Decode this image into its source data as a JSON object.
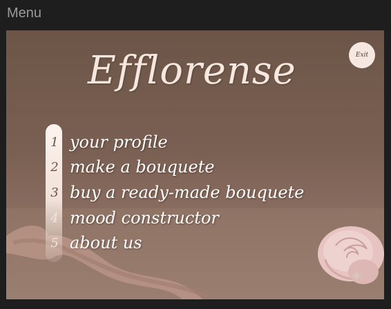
{
  "window": {
    "title": "Menu"
  },
  "app": {
    "logo_text": "Efflorense"
  },
  "exit_button": {
    "label": "Exit"
  },
  "menu": {
    "items": [
      {
        "number": "1",
        "label": "your profile"
      },
      {
        "number": "2",
        "label": "make a bouquete"
      },
      {
        "number": "3",
        "label": "buy a ready-made bouquete"
      },
      {
        "number": "4",
        "label": "mood constructor"
      },
      {
        "number": "5",
        "label": "about us"
      }
    ]
  },
  "colors": {
    "background_top": "#6c5548",
    "background_bottom": "#94796b",
    "logo": "#f6e7df",
    "exit_button_bg": "#f7e7e1",
    "menu_text": "#ffffff",
    "window_chrome": "#1e1e1f"
  },
  "icons": [
    "sparkle-icon",
    "rose-decoration",
    "ribbon-decoration"
  ]
}
